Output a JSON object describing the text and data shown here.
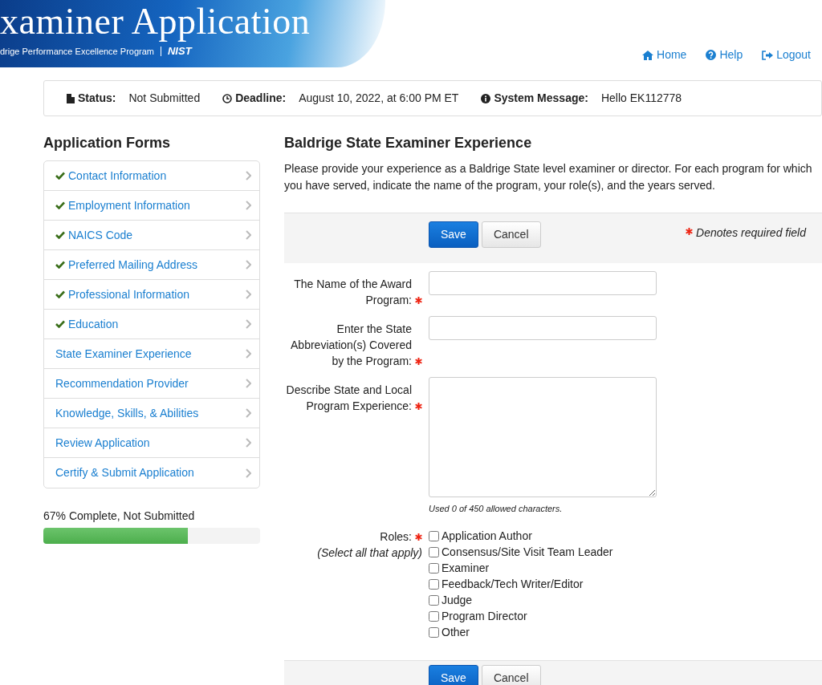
{
  "header": {
    "title": "xaminer Application",
    "subtitle": "drige Performance Excellence Program",
    "logo": "NIST"
  },
  "top_nav": [
    {
      "label": "Home"
    },
    {
      "label": "Help"
    },
    {
      "label": "Logout"
    }
  ],
  "status_bar": [
    {
      "label": "Status:",
      "value": "Not Submitted"
    },
    {
      "label": "Deadline:",
      "value": "August 10, 2022, at 6:00 PM ET"
    },
    {
      "label": "System Message:",
      "value": "Hello EK112778"
    }
  ],
  "sidebar": {
    "title": "Application Forms",
    "items": [
      {
        "label": "Contact Information",
        "completed": true
      },
      {
        "label": "Employment Information",
        "completed": true
      },
      {
        "label": "NAICS Code",
        "completed": true
      },
      {
        "label": "Preferred Mailing Address",
        "completed": true
      },
      {
        "label": "Professional Information",
        "completed": true
      },
      {
        "label": "Education",
        "completed": true
      },
      {
        "label": "State Examiner Experience",
        "completed": false
      },
      {
        "label": "Recommendation Provider",
        "completed": false
      },
      {
        "label": "Knowledge, Skills, & Abilities",
        "completed": false
      },
      {
        "label": "Review Application",
        "completed": false
      },
      {
        "label": "Certify & Submit Application",
        "completed": false
      }
    ],
    "progress": {
      "label": "67% Complete, Not Submitted",
      "level": 0.667
    }
  },
  "main": {
    "title": "Baldrige State Examiner Experience",
    "description": "Please provide your experience as a Baldrige State level examiner or director. For each program for which you have served, indicate the name of the program, your role(s), and the years served.",
    "toolbar": {
      "buttons": [
        "Save",
        "Cancel"
      ],
      "required_note": "Denotes required field"
    },
    "fields": [
      {
        "kind": "text",
        "label": "The Name of the Award Program:",
        "required": true
      },
      {
        "kind": "text",
        "label": "Enter the State Abbreviation(s) Covered by the Program:",
        "required": true
      },
      {
        "kind": "textarea",
        "label": "Describe State and Local Program Experience:",
        "required": true,
        "help": "Used 0 of 450 allowed characters."
      }
    ],
    "roles": {
      "label": "Roles:",
      "hint": "(Select all that apply)",
      "required": true,
      "options": [
        {
          "label": "Application Author",
          "checked": false
        },
        {
          "label": "Consensus/Site Visit Team Leader",
          "checked": false
        },
        {
          "label": "Examiner",
          "checked": false
        },
        {
          "label": "Feedback/Tech Writer/Editor",
          "checked": false
        },
        {
          "label": "Judge",
          "checked": false
        },
        {
          "label": "Program Director",
          "checked": false
        },
        {
          "label": "Other",
          "checked": false
        }
      ]
    },
    "bottom_toolbar": {
      "buttons": [
        "Save",
        "Cancel"
      ]
    }
  }
}
